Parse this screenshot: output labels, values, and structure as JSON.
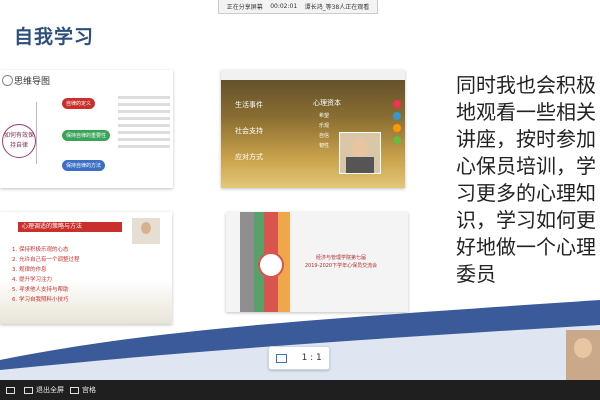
{
  "status_bar": {
    "label": "正在分享屏幕",
    "timer": "00:02:01",
    "viewers": "谭长鸿_等38人正在观看"
  },
  "slide": {
    "title": "自我学习",
    "body_text": "同时我也会积极地观看一些相关讲座，按时参加心保员培训，学习更多的心理知识，学习如何更好地做一个心理委员"
  },
  "thumb1": {
    "title": "思维导图",
    "center": "如何有效保持自律",
    "nodes": [
      "自律的定义",
      "保持自律的重要性",
      "保持自律的方法"
    ]
  },
  "thumb2": {
    "items": [
      "生活事件",
      "社会支持",
      "应对方式"
    ],
    "right_items": [
      "心理资本",
      "希望",
      "乐观",
      "自信",
      "韧性"
    ]
  },
  "thumb3": {
    "banner": "心理调适的策略与方法",
    "items": [
      "1. 保持积极乐观的心态",
      "2. 允许自己有一个调整过程",
      "3. 规律的作息",
      "4. 提升学习注力",
      "5. 寻求他人支持与帮助",
      "6. 学习自我照料小技巧"
    ]
  },
  "thumb4": {
    "line1": "经济与管理学院第七届",
    "line2": "2019-2020下学年心保员交流会"
  },
  "view_ratio": "1 : 1",
  "bottom_bar": {
    "exit_fullscreen": "退出全屏",
    "grid": "宫格"
  },
  "colors": {
    "title_blue": "#2d4f7c",
    "accent_red": "#c9302c",
    "wave_blue": "#3b5a9a"
  }
}
